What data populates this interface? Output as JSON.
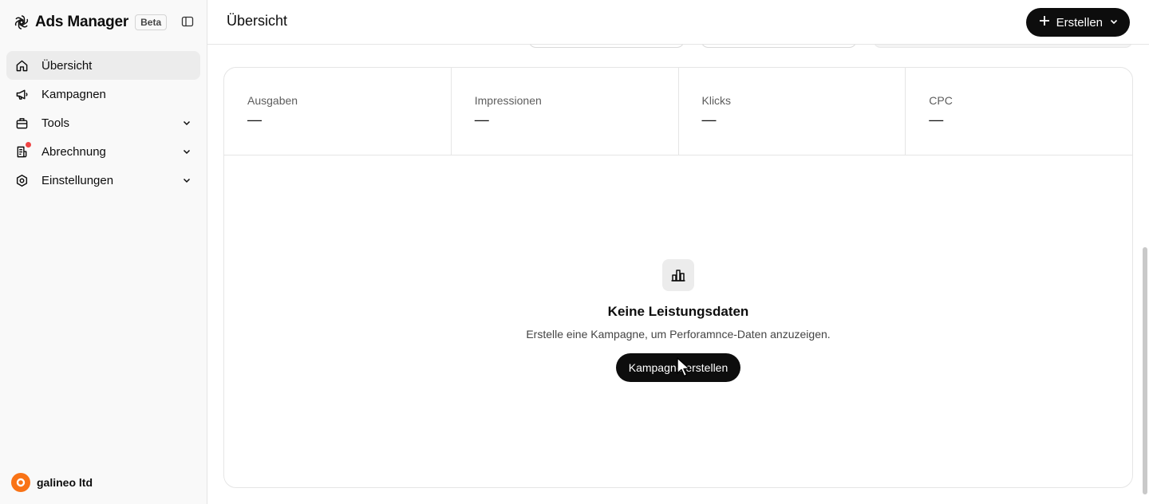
{
  "app": {
    "title": "Ads Manager",
    "badge": "Beta"
  },
  "sidebar": {
    "items": [
      {
        "label": "Übersicht",
        "icon": "home-icon",
        "active": true
      },
      {
        "label": "Kampagnen",
        "icon": "megaphone-icon"
      },
      {
        "label": "Tools",
        "icon": "toolbox-icon"
      },
      {
        "label": "Abrechnung",
        "icon": "receipt-icon"
      },
      {
        "label": "Einstellungen",
        "icon": "gear-icon"
      }
    ],
    "account": {
      "name": "galineo ltd"
    }
  },
  "header": {
    "title": "Übersicht",
    "create_label": "Erstellen"
  },
  "metrics": [
    {
      "label": "Ausgaben",
      "value": "—"
    },
    {
      "label": "Impressionen",
      "value": "—"
    },
    {
      "label": "Klicks",
      "value": "—"
    },
    {
      "label": "CPC",
      "value": "—"
    }
  ],
  "empty_state": {
    "title": "Keine Leistungsdaten",
    "description": "Erstelle eine Kampagne, um Perforamnce-Daten anzuzeigen.",
    "button_label": "Kampagne erstellen"
  },
  "colors": {
    "primary": "#0d0d0d",
    "notification": "#ef4444",
    "avatar": "#f97316"
  }
}
